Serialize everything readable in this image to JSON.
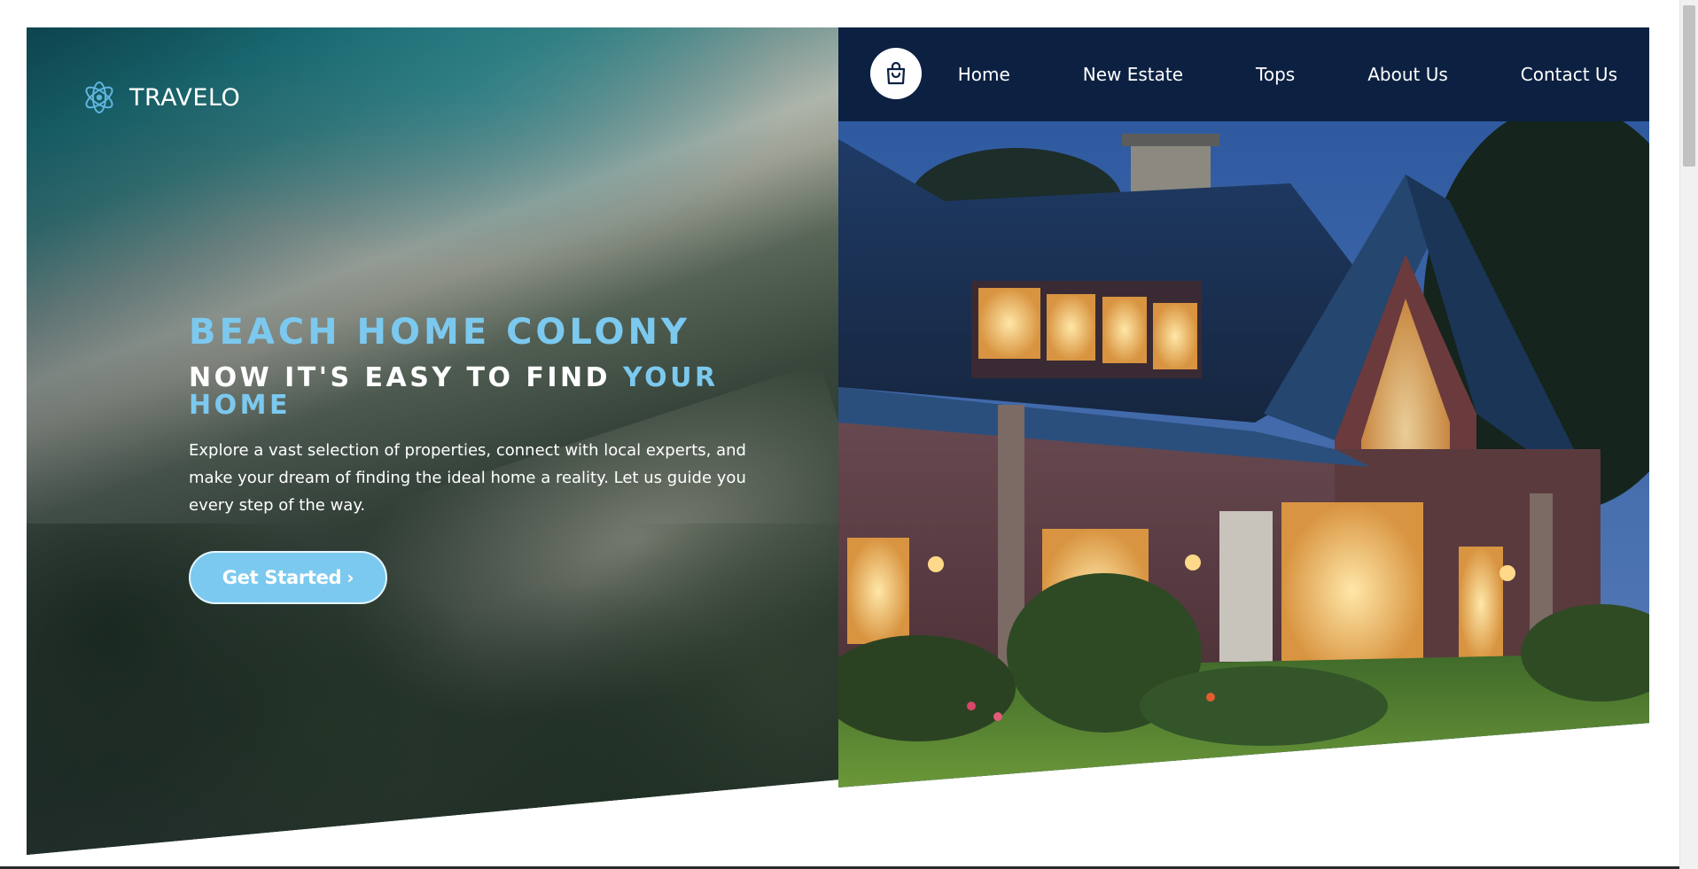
{
  "brand": {
    "name": "TRAVELO",
    "icon": "atom-icon",
    "accent_color": "#7cc9ef",
    "nav_color": "#0c2141"
  },
  "nav": {
    "cart_icon": "shopping-bag-icon",
    "items": [
      {
        "label": "Home"
      },
      {
        "label": "New Estate"
      },
      {
        "label": "Tops"
      },
      {
        "label": "About Us"
      },
      {
        "label": "Contact Us"
      }
    ]
  },
  "hero": {
    "title": "BEACH HOME COLONY",
    "subtitle_main": "NOW IT'S EASY TO FIND ",
    "subtitle_accent": "YOUR HOME",
    "description": "Explore a vast selection of properties, connect with local experts, and make your dream of finding the ideal home a reality. Let us guide you every step of the way.",
    "cta_label": "Get Started",
    "cta_icon": "chevron-right-icon"
  }
}
